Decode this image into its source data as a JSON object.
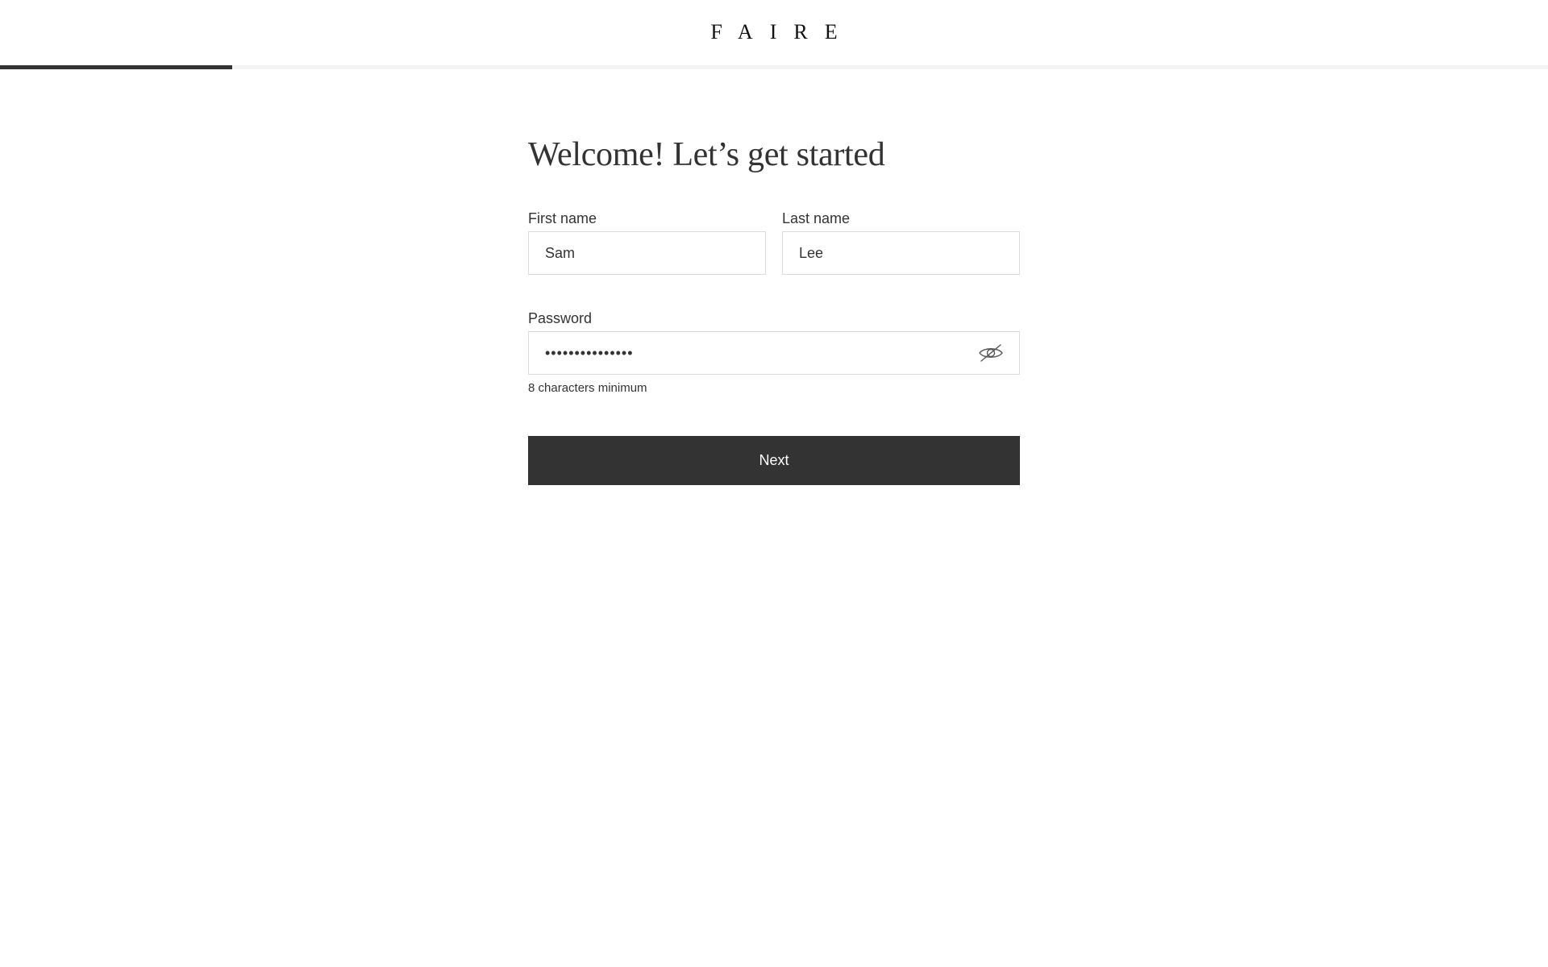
{
  "header": {
    "logo_text": "FAIRE"
  },
  "progress": {
    "fraction": 0.15
  },
  "form": {
    "title": "Welcome! Let’s get started",
    "first_name": {
      "label": "First name",
      "value": "Sam"
    },
    "last_name": {
      "label": "Last name",
      "value": "Lee"
    },
    "password": {
      "label": "Password",
      "value": "•••••••••••••••",
      "hint": "8 characters minimum",
      "toggle_icon": "eye-slash-icon"
    },
    "next_label": "Next"
  },
  "colors": {
    "primary": "#333333",
    "border": "#dcdcdc",
    "track": "#f3f3f3"
  }
}
